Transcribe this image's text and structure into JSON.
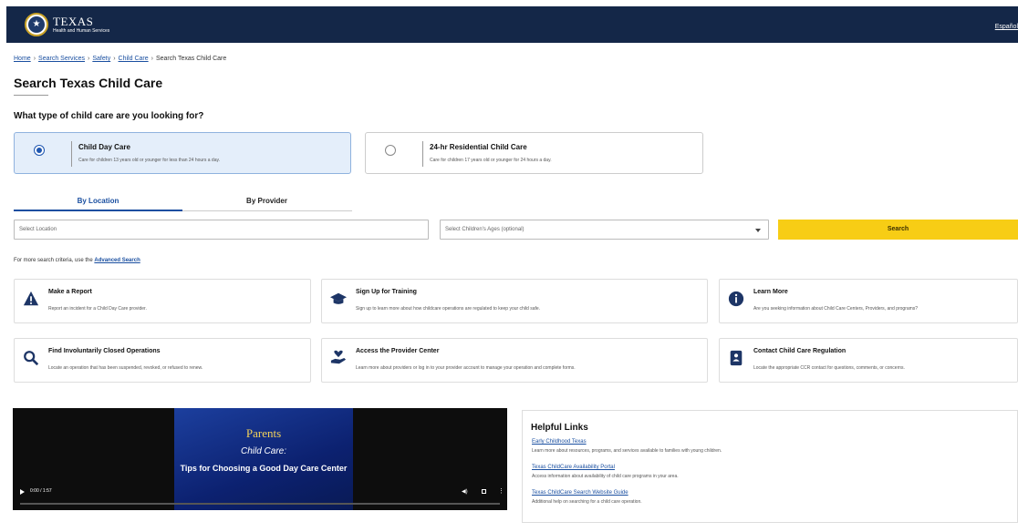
{
  "header": {
    "logo_title": "TEXAS",
    "logo_subtitle": "Health and Human Services",
    "language_link": "Español"
  },
  "breadcrumb": [
    "Home",
    "Search Services",
    "Safety",
    "Child Care",
    "Search Texas Child Care"
  ],
  "page_title": "Search Texas Child Care",
  "question": "What type of child care are you looking for?",
  "care_types": [
    {
      "title": "Child Day Care",
      "desc": "Care for children 13 years old or younger for less than 24 hours a day.",
      "selected": true
    },
    {
      "title": "24-hr Residential Child Care",
      "desc": "Care for children 17 years old or younger for 24 hours a day.",
      "selected": false
    }
  ],
  "tabs": [
    {
      "label": "By Location",
      "active": true
    },
    {
      "label": "By Provider",
      "active": false
    }
  ],
  "search": {
    "location_placeholder": "Select Location",
    "ages_placeholder": "Select Children's Ages (optional)",
    "button": "Search"
  },
  "advanced": {
    "prefix": "For more search criteria, use the",
    "link": "Advanced Search"
  },
  "actions": [
    {
      "title": "Make a Report",
      "desc": "Report an incident for a Child Day Care provider.",
      "icon": "warning-icon"
    },
    {
      "title": "Sign Up for Training",
      "desc": "Sign up to learn more about how childcare operations are regulated to keep your child safe.",
      "icon": "graduation-cap-icon"
    },
    {
      "title": "Learn More",
      "desc": "Are you seeking information about Child Care Centers, Providers, and programs?",
      "icon": "info-icon"
    },
    {
      "title": "Find Involuntarily Closed Operations",
      "desc": "Locate an operation that has been suspended, revoked, or refused to renew.",
      "icon": "search-icon"
    },
    {
      "title": "Access the Provider Center",
      "desc": "Learn more about providers or log in to your provider account to manage your operation and complete forms.",
      "icon": "heart-hand-icon"
    },
    {
      "title": "Contact Child Care Regulation",
      "desc": "Locate the appropriate CCR contact for questions, comments, or concerns.",
      "icon": "contact-book-icon"
    }
  ],
  "video": {
    "line1": "Parents",
    "line2": "Child Care:",
    "line3": "Tips for Choosing a Good Day Care Center",
    "time": "0:00 / 1:57",
    "progress": 0
  },
  "helpful_links": {
    "title": "Helpful Links",
    "items": [
      {
        "title": "Early Childhood Texas",
        "desc": "Learn more about resources, programs, and services available to families with young children."
      },
      {
        "title": "Texas ChildCare Availability Portal",
        "desc": "Access information about availability of child care programs in your area."
      },
      {
        "title": "Texas ChildCare Search Website Guide",
        "desc": "Additional help on searching for a child care operation."
      }
    ]
  },
  "colors": {
    "header_bg": "#142748",
    "link": "#1a4fa0",
    "search_button": "#f7cd15",
    "selected_card": "#e4eefa",
    "icon": "#1d3566"
  }
}
